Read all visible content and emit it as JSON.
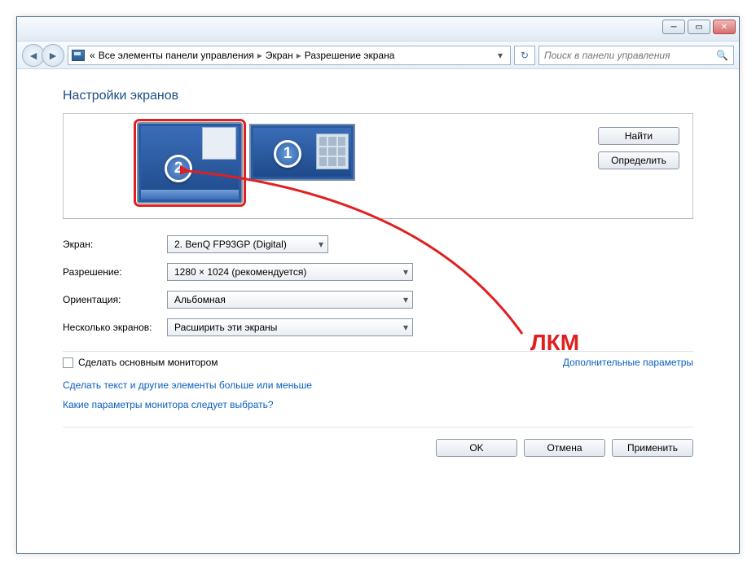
{
  "breadcrumb": {
    "p1": "«",
    "p2": "Все элементы панели управления",
    "p3": "Экран",
    "p4": "Разрешение экрана"
  },
  "search": {
    "placeholder": "Поиск в панели управления"
  },
  "heading": "Настройки экранов",
  "monitors": {
    "badge2": "2",
    "badge1": "1"
  },
  "side_buttons": {
    "find": "Найти",
    "identify": "Определить"
  },
  "labels": {
    "screen": "Экран:",
    "resolution": "Разрешение:",
    "orientation": "Ориентация:",
    "multi": "Несколько экранов:"
  },
  "combos": {
    "screen": "2. BenQ FP93GP (Digital)",
    "resolution": "1280 × 1024 (рекомендуется)",
    "orientation": "Альбомная",
    "multi": "Расширить эти экраны"
  },
  "checkbox_label": "Сделать основным монитором",
  "adv_link": "Дополнительные параметры",
  "links": {
    "text_size": "Сделать текст и другие элементы больше или меньше",
    "which_settings": "Какие параметры монитора следует выбрать?"
  },
  "buttons": {
    "ok": "OK",
    "cancel": "Отмена",
    "apply": "Применить"
  },
  "annotation": "ЛКМ"
}
